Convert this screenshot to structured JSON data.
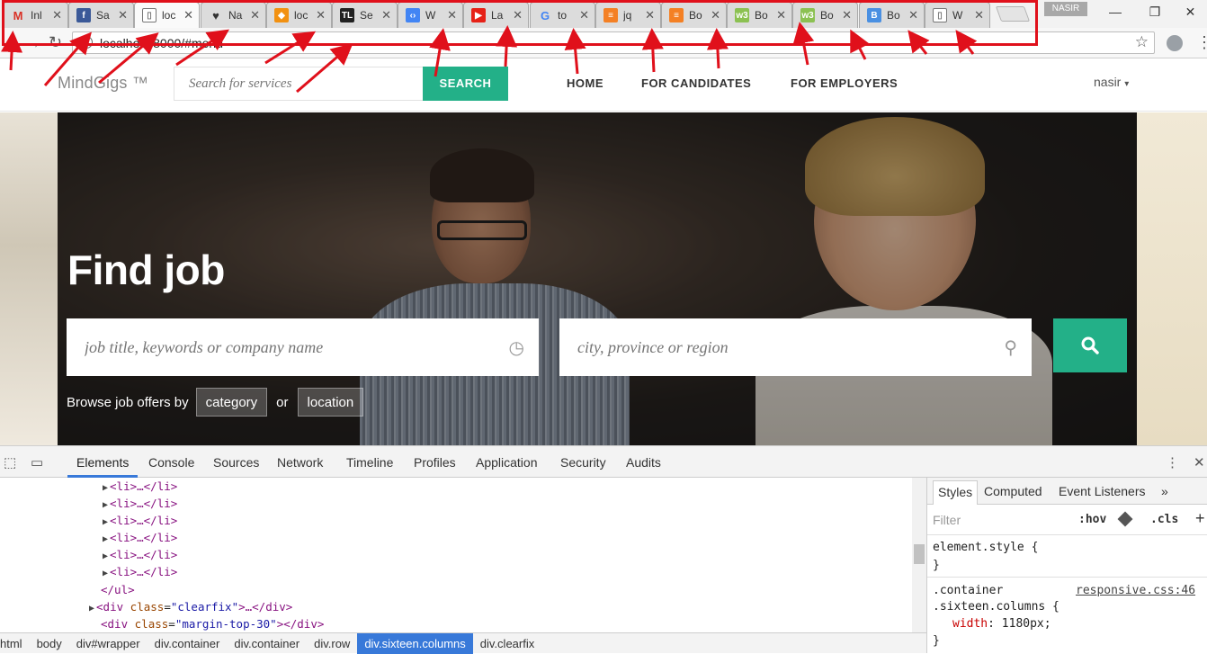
{
  "browser": {
    "tabs": [
      {
        "label": "Inl",
        "favicon": "gmail-icon",
        "color": "#d93025",
        "glyph": "M"
      },
      {
        "label": "Sa",
        "favicon": "facebook-icon",
        "color": "#3b5998",
        "glyph": "f"
      },
      {
        "label": "loc",
        "favicon": "page-icon",
        "color": "#ffffff",
        "glyph": "▯"
      },
      {
        "label": "Na",
        "favicon": "heart-icon",
        "color": "#333333",
        "glyph": "♥"
      },
      {
        "label": "loc",
        "favicon": "phpmyadmin-icon",
        "color": "#f29111",
        "glyph": "◆"
      },
      {
        "label": "Se",
        "favicon": "tl-icon",
        "color": "#222222",
        "glyph": "TL"
      },
      {
        "label": "W",
        "favicon": "code-icon",
        "color": "#4285f4",
        "glyph": "‹›"
      },
      {
        "label": "La",
        "favicon": "youtube-icon",
        "color": "#e62117",
        "glyph": "▶"
      },
      {
        "label": "to",
        "favicon": "google-icon",
        "color": "#4285f4",
        "glyph": "G"
      },
      {
        "label": "jq",
        "favicon": "stackoverflow-icon",
        "color": "#f48024",
        "glyph": "≡"
      },
      {
        "label": "Bo",
        "favicon": "stackoverflow-icon",
        "color": "#f48024",
        "glyph": "≡"
      },
      {
        "label": "Bo",
        "favicon": "w3schools-icon",
        "color": "#8cc152",
        "glyph": "w3"
      },
      {
        "label": "Bo",
        "favicon": "w3schools-icon",
        "color": "#8cc152",
        "glyph": "w3"
      },
      {
        "label": "Bo",
        "favicon": "bootstrap-icon",
        "color": "#4a90e2",
        "glyph": "B"
      },
      {
        "label": "W",
        "favicon": "page-icon",
        "color": "#ffffff",
        "glyph": "▯"
      }
    ],
    "profile": "NASIR",
    "url": "localhost:8000/#menu"
  },
  "site": {
    "logo": "MindGigs ™",
    "search_placeholder": "Search for services",
    "search_button": "SEARCH",
    "nav": [
      "HOME",
      "FOR CANDIDATES",
      "FOR EMPLOYERS"
    ],
    "user": "nasir"
  },
  "hero": {
    "title": "Find job",
    "keywords_placeholder": "job title, keywords or company name",
    "location_placeholder": "city, province or region",
    "browse_text": "Browse job offers by",
    "category": "category",
    "or": "or",
    "location": "location"
  },
  "devtools": {
    "tabs": [
      "Elements",
      "Console",
      "Sources",
      "Network",
      "Timeline",
      "Profiles",
      "Application",
      "Security",
      "Audits"
    ],
    "dom": {
      "li": "<li>…</li>",
      "ul_close": "</ul>",
      "div_open": "<div ",
      "class_attr": "class",
      "clearfix_val": "\"clearfix\"",
      "clearfix_rest": ">…</div>",
      "margin_val": "\"margin-top-30\"",
      "margin_rest": "></div>"
    },
    "breadcrumbs": [
      "html",
      "body",
      "div#wrapper",
      "div.container",
      "div.container",
      "div.row",
      "div.sixteen.columns",
      "div.clearfix"
    ],
    "styles_tabs": [
      "Styles",
      "Computed",
      "Event Listeners"
    ],
    "filter_placeholder": "Filter",
    "hov": ":hov",
    "cls": ".cls",
    "element_style": "element.style {",
    "close_brace": "}",
    "rule_selector_1": ".container",
    "rule_selector_2": ".sixteen.columns {",
    "rule_source": "responsive.css:46",
    "rule_prop": "width",
    "rule_value": "1180px;"
  },
  "colors": {
    "accent": "#23b088",
    "annotation": "#e0101b",
    "devtools_active": "#3879d9"
  }
}
